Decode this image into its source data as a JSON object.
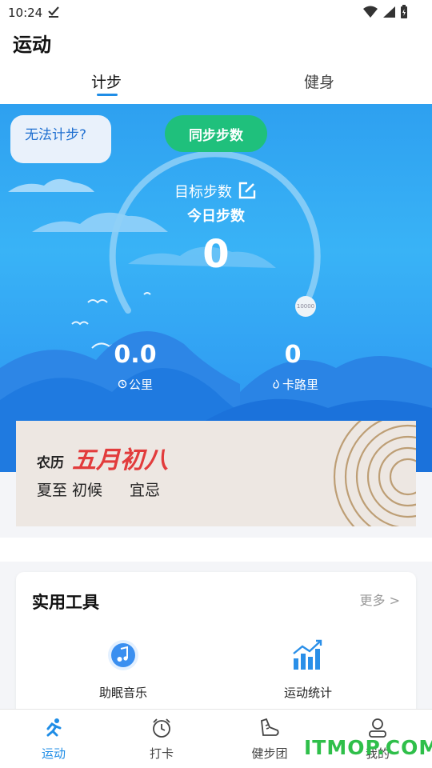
{
  "status_bar": {
    "time": "10:24"
  },
  "header": {
    "title": "运动"
  },
  "tabs": [
    {
      "label": "计步",
      "active": true
    },
    {
      "label": "健身",
      "active": false
    }
  ],
  "pedometer": {
    "help_text": "无法计步?",
    "sync_label": "同步步数",
    "goal_label": "目标步数",
    "today_label": "今日步数",
    "steps": "0",
    "goal_marker": "10000",
    "progress_fraction": 0,
    "distance_value": "0.0",
    "distance_label": "公里",
    "calories_value": "0",
    "calories_label": "卡路里"
  },
  "lunar": {
    "prefix": "农历",
    "date": "五月初八",
    "solar_term": "夏至 初候",
    "advice": "宜忌"
  },
  "tools": {
    "title": "实用工具",
    "more": "更多 >",
    "items": [
      {
        "label": "助眠音乐",
        "icon": "music-note-icon"
      },
      {
        "label": "运动统计",
        "icon": "bar-chart-icon"
      }
    ]
  },
  "bottom_nav": [
    {
      "label": "运动",
      "icon": "running-icon",
      "active": true
    },
    {
      "label": "打卡",
      "icon": "alarm-clock-icon",
      "active": false
    },
    {
      "label": "健步团",
      "icon": "shoe-icon",
      "active": false
    },
    {
      "label": "我的",
      "icon": "user-icon",
      "active": false
    }
  ],
  "watermark": "ITMOP.COM",
  "colors": {
    "accent": "#1f8de6",
    "sync_button": "#1fc07c",
    "lunar_date": "#e23c3c",
    "hero_sky": "#39b3f6"
  }
}
